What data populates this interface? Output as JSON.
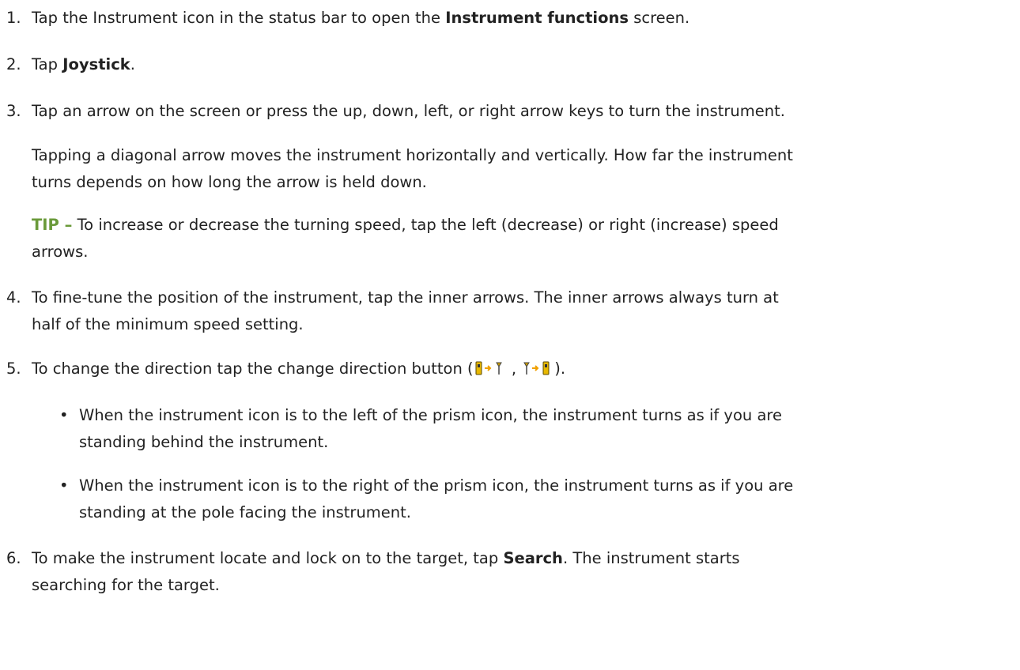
{
  "steps": [
    {
      "num": "1.",
      "pre": "Tap the Instrument icon in the status bar to open the ",
      "bold": "Instrument functions",
      "post": " screen."
    },
    {
      "num": "2.",
      "pre": "Tap ",
      "bold": "Joystick",
      "post": "."
    },
    {
      "num": "3.",
      "text": "Tap an arrow on the screen or press the up, down, left, or right arrow keys to turn the instrument.",
      "para_line1": "Tapping a diagonal arrow moves the instrument horizontally and vertically. How far the instrument",
      "para_line2": "turns depends on how long the arrow is held down.",
      "tip_label": "TIP –",
      "tip_line1": " To increase or decrease the turning speed, tap the left (decrease) or right (increase) speed",
      "tip_line2": "arrows."
    },
    {
      "num": "4.",
      "line1": "To fine-tune the position of the instrument, tap the inner arrows. The inner arrows always turn at",
      "line2": "half of the minimum speed setting."
    },
    {
      "num": "5.",
      "pre": "To change the direction tap the change direction button (",
      "sep": " , ",
      "post": ").",
      "icon_a": "instrument-to-prism-icon",
      "icon_b": "prism-to-instrument-icon",
      "bullets": [
        {
          "dot": "•",
          "line1": "When the instrument icon is to the left of the prism icon, the instrument turns as if you are",
          "line2": "standing behind the instrument."
        },
        {
          "dot": "•",
          "line1": "When the instrument icon is to the right of the prism icon, the instrument turns as if you are",
          "line2": "standing at the pole facing the instrument."
        }
      ]
    },
    {
      "num": "6.",
      "pre": "To make the instrument locate and lock on to the target, tap ",
      "bold": "Search",
      "post": ". The instrument starts",
      "line2": "searching for the target."
    }
  ],
  "colors": {
    "text": "#222222",
    "tip": "#6a9a3a"
  }
}
